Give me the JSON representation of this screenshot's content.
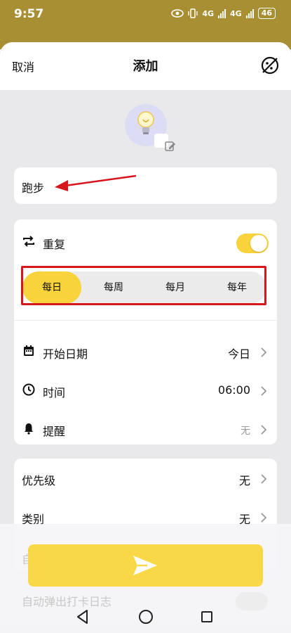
{
  "status": {
    "time": "9:57",
    "net1": "4G",
    "net2": "4G",
    "battery": "46"
  },
  "header": {
    "cancel": "取消",
    "title": "添加"
  },
  "task": {
    "name": "跑步"
  },
  "repeat": {
    "label": "重复",
    "enabled": true,
    "options": [
      "每日",
      "每周",
      "每月",
      "每年"
    ],
    "selected": "每日"
  },
  "schedule": {
    "start_date_label": "开始日期",
    "start_date_value": "今日",
    "time_label": "时间",
    "time_value": "06:00",
    "reminder_label": "提醒",
    "reminder_value": "无"
  },
  "meta": {
    "priority_label": "优先级",
    "priority_value": "无",
    "category_label": "类别",
    "category_value": "无"
  },
  "hidden": {
    "partial_row": "自",
    "auto_log_label": "自动弹出打卡日志"
  },
  "colors": {
    "accent": "#f9d33c",
    "status_bar": "#a98f33",
    "annotation": "#d8141c"
  },
  "icons": [
    "theme-icon",
    "bulb-icon",
    "edit-icon",
    "repeat-icon",
    "calendar-icon",
    "clock-icon",
    "bell-icon",
    "chevron-right-icon",
    "send-icon"
  ]
}
